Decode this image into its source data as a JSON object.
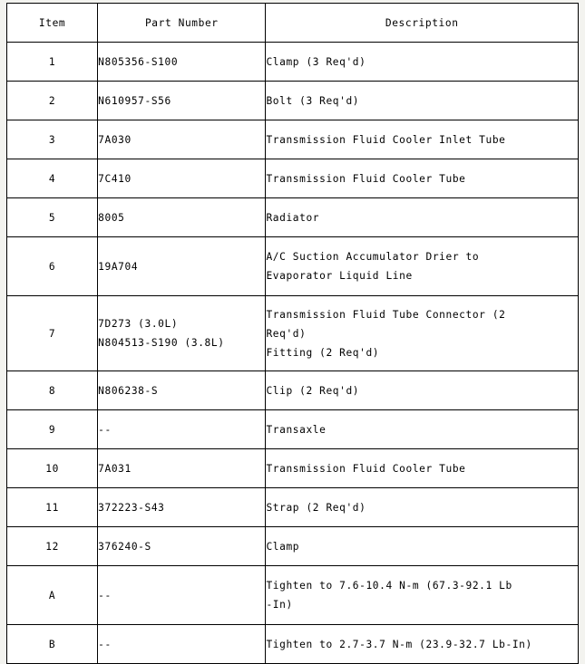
{
  "table": {
    "headers": [
      "Item",
      "Part Number",
      "Description"
    ],
    "rows": [
      {
        "item": "1",
        "part_lines": [
          "N805356-S100"
        ],
        "desc_lines": [
          "Clamp (3 Req'd)"
        ]
      },
      {
        "item": "2",
        "part_lines": [
          "N610957-S56"
        ],
        "desc_lines": [
          "Bolt (3 Req'd)"
        ]
      },
      {
        "item": "3",
        "part_lines": [
          "7A030"
        ],
        "desc_lines": [
          "Transmission Fluid Cooler Inlet Tube"
        ]
      },
      {
        "item": "4",
        "part_lines": [
          "7C410"
        ],
        "desc_lines": [
          "Transmission Fluid Cooler Tube"
        ]
      },
      {
        "item": "5",
        "part_lines": [
          "8005"
        ],
        "desc_lines": [
          "Radiator"
        ]
      },
      {
        "item": "6",
        "part_lines": [
          "19A704"
        ],
        "desc_lines": [
          "A/C Suction Accumulator Drier to",
          "Evaporator Liquid Line"
        ]
      },
      {
        "item": "7",
        "part_lines": [
          "7D273 (3.0L)",
          "N804513-S190 (3.8L)"
        ],
        "desc_lines": [
          "Transmission Fluid Tube Connector (2",
          "Req'd)",
          "Fitting (2 Req'd)"
        ]
      },
      {
        "item": "8",
        "part_lines": [
          "N806238-S"
        ],
        "desc_lines": [
          "Clip (2 Req'd)"
        ]
      },
      {
        "item": "9",
        "part_lines": [
          "--"
        ],
        "desc_lines": [
          "Transaxle"
        ]
      },
      {
        "item": "10",
        "part_lines": [
          "7A031"
        ],
        "desc_lines": [
          "Transmission Fluid Cooler Tube"
        ]
      },
      {
        "item": "11",
        "part_lines": [
          "372223-S43"
        ],
        "desc_lines": [
          "Strap (2 Req'd)"
        ]
      },
      {
        "item": "12",
        "part_lines": [
          "376240-S"
        ],
        "desc_lines": [
          "Clamp"
        ]
      },
      {
        "item": "A",
        "part_lines": [
          "--"
        ],
        "desc_lines": [
          "Tighten to 7.6-10.4 N-m (67.3-92.1 Lb",
          "-In)"
        ]
      },
      {
        "item": "B",
        "part_lines": [
          "--"
        ],
        "desc_lines": [
          "Tighten to 2.7-3.7 N-m (23.9-32.7 Lb-In)"
        ]
      }
    ]
  },
  "colors": {
    "page_background": "#f3f3ef",
    "cell_background": "#ffffff",
    "border": "#000000",
    "text": "#000000"
  }
}
